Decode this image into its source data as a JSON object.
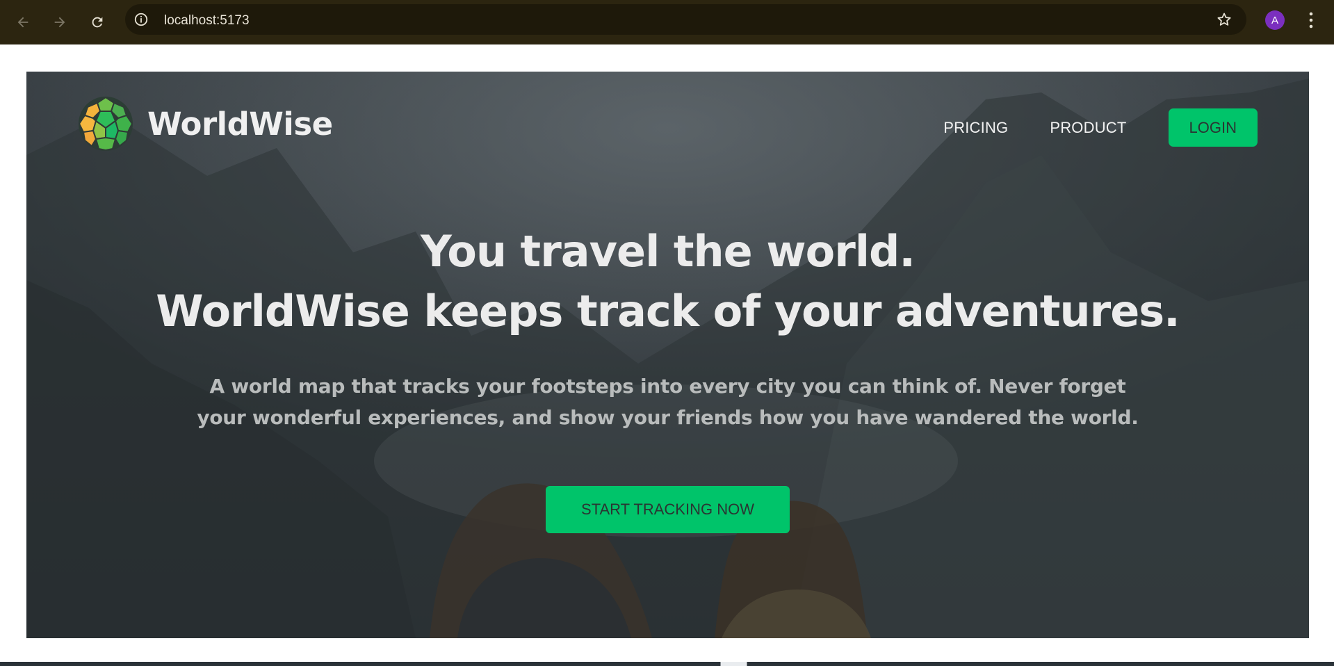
{
  "browser": {
    "url": "localhost:5173",
    "profile_initial": "A",
    "icons": {
      "back": "arrow-left-icon",
      "forward": "arrow-right-icon",
      "reload": "reload-icon",
      "site_info": "info-icon",
      "bookmark": "star-icon",
      "menu": "kebab-menu-icon"
    }
  },
  "nav": {
    "brand_name": "WorldWise",
    "links": [
      "PRICING",
      "PRODUCT"
    ],
    "login_label": "LOGIN"
  },
  "hero": {
    "headline_line1": "You travel the world.",
    "headline_line2": "WorldWise keeps track of your adventures.",
    "subtitle": "A world map that tracks your footsteps into every city you can think of. Never forget your wonderful experiences, and show your friends how you have wandered the world.",
    "cta_label": "START TRACKING NOW"
  },
  "colors": {
    "accent": "#00c46a",
    "browser_bar": "#2c2510",
    "avatar": "#7b2fbf",
    "text_light": "#ececec"
  }
}
